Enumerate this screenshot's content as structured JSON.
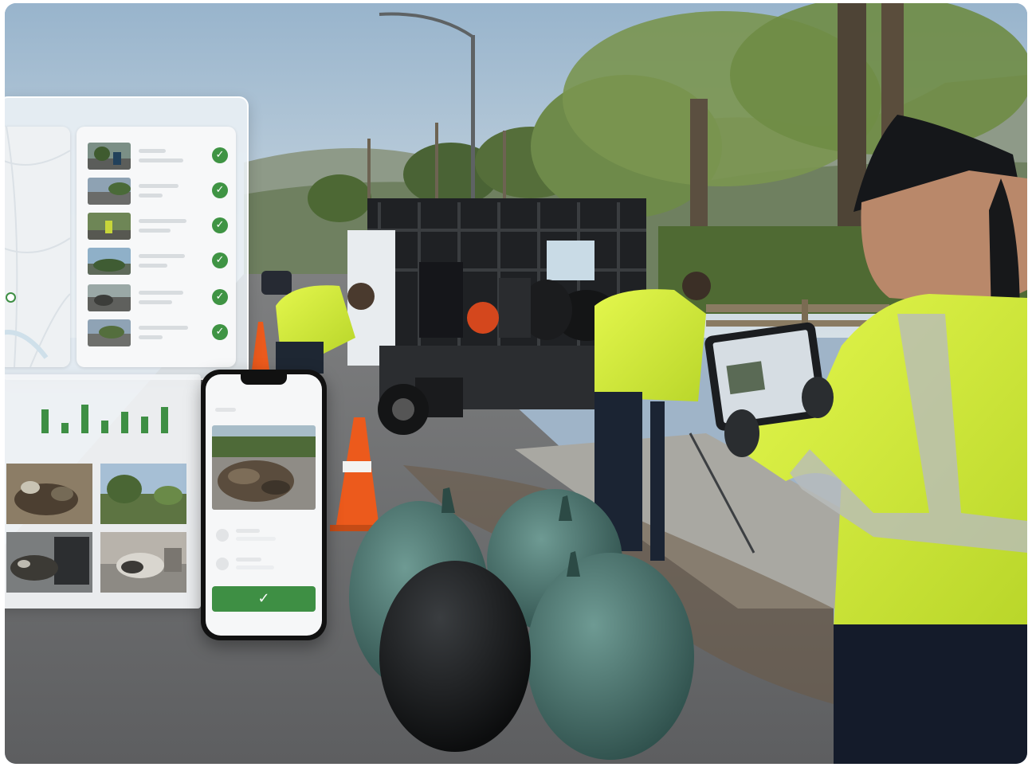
{
  "image": {
    "description_colors": {
      "accent_green": "#3e8f44",
      "vest_yellow": "#d7f23a",
      "sky": "#a9bed0"
    }
  },
  "overlay": {
    "list_items": [
      {
        "status": "check-icon"
      },
      {
        "status": "check-icon"
      },
      {
        "status": "check-icon"
      },
      {
        "status": "check-icon"
      },
      {
        "status": "check-icon"
      },
      {
        "status": "check-icon"
      }
    ],
    "check_glyph": "✓",
    "bars": [
      0.8,
      0.35,
      0.95,
      0.42,
      0.7,
      0.55,
      0.88
    ],
    "confirm_glyph": "✓"
  }
}
